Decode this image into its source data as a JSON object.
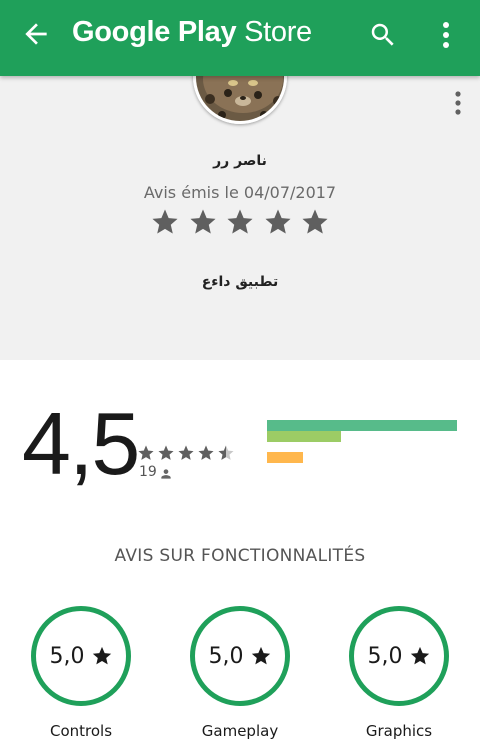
{
  "appbar": {
    "title_brand": "Google Play",
    "title_suffix": " Store"
  },
  "review": {
    "reviewer": "ناصر رر",
    "date": "Avis émis le 04/07/2017",
    "rating": 5,
    "text": "تطبيق داءع"
  },
  "summary": {
    "score": "4,5",
    "count": "19",
    "rating_stars": 4.5,
    "bars": [
      {
        "fraction": 1.0,
        "color": "#57bb8a"
      },
      {
        "fraction": 0.39,
        "color": "#9ccc65"
      },
      {
        "fraction": 0.0,
        "color": "#ffca28"
      },
      {
        "fraction": 0.19,
        "color": "#ffb74d"
      },
      {
        "fraction": 0.0,
        "color": "#ff8a65"
      }
    ]
  },
  "features": {
    "title": "AVIS SUR FONCTIONNALITÉS",
    "items": [
      {
        "value": "5,0",
        "label": "Controls"
      },
      {
        "value": "5,0",
        "label": "Gameplay"
      },
      {
        "value": "5,0",
        "label": "Graphics"
      }
    ]
  },
  "colors": {
    "accent": "#1fa05a",
    "review_bg": "#f1f1f1",
    "star_gray": "#5f5f5f"
  },
  "icons": {
    "back": "arrow-left-icon",
    "search": "search-icon",
    "more": "more-vert-icon",
    "star": "star-icon",
    "person": "person-icon"
  }
}
